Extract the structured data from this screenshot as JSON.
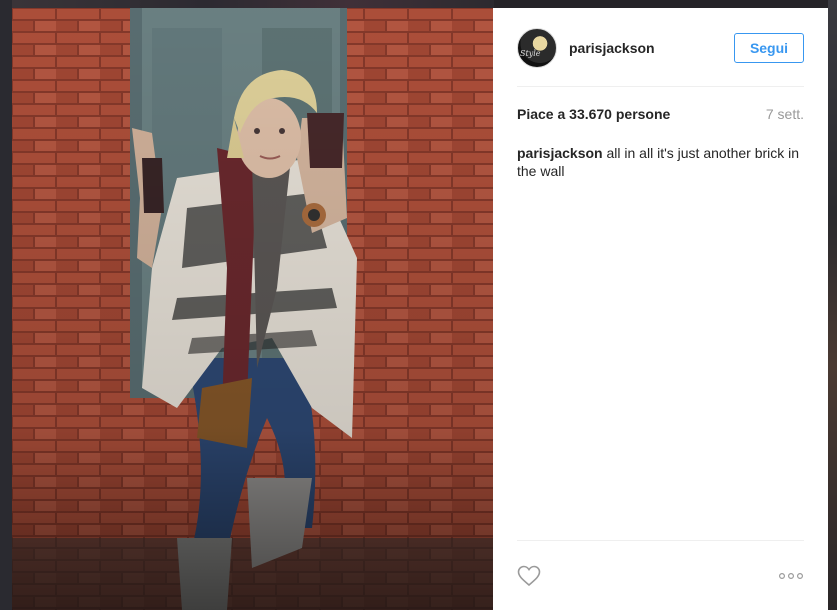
{
  "post": {
    "username": "parisjackson",
    "avatar_text": "Style",
    "follow_label": "Segui",
    "likes": "Piace a 33.670 persone",
    "time": "7 sett.",
    "caption_user": "parisjackson",
    "caption_text": "all in all it's just another brick in the wall"
  },
  "icons": {
    "like": "heart-outline-icon",
    "more": "more-options-icon"
  },
  "colors": {
    "accent": "#3897f0",
    "text": "#262626",
    "muted": "#999999"
  }
}
